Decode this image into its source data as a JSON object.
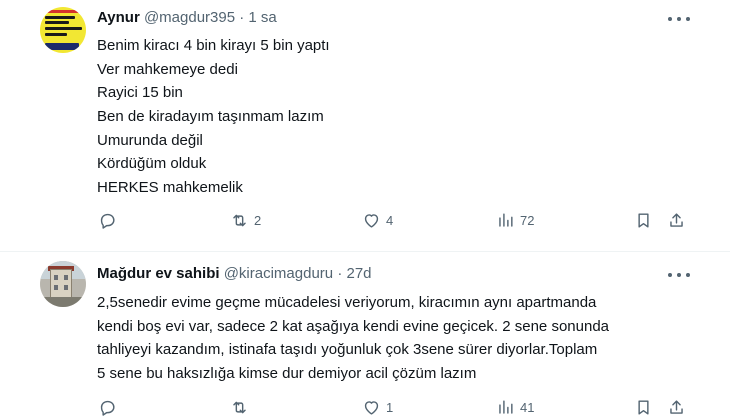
{
  "tweets": [
    {
      "author": {
        "name": "Aynur",
        "handle": "@magdur395",
        "time": "1 sa",
        "avatar_text": [
          "SON 2520 GÜN",
          "KURALI"
        ]
      },
      "separator": "·",
      "lines": [
        "Benim kiracı 4 bin kirayı 5 bin yaptı",
        "Ver mahkemeye dedi",
        "Rayici 15 bin",
        "Ben de kiradayım taşınmam lazım",
        "Umurunda değil",
        "Kördüğüm olduk",
        "HERKES mahkemelik"
      ],
      "actions": {
        "reply": "",
        "retweet": "2",
        "like": "4",
        "views": "72"
      }
    },
    {
      "author": {
        "name": "Mağdur ev sahibi",
        "handle": "@kiracimagduru",
        "time": "27d"
      },
      "separator": "·",
      "lines": [
        "2,5senedir evime geçme mücadelesi veriyorum, kiracımın aynı apartmanda",
        "kendi boş evi var, sadece 2 kat aşağıya kendi evine geçicek. 2 sene sonunda",
        "tahliyeyi kazandım, istinafa taşıdı yoğunluk çok 3sene sürer diyorlar.Toplam",
        "5 sene bu haksızlığa kimse dur demiyor acil çözüm lazım"
      ],
      "actions": {
        "reply": "",
        "retweet": "",
        "like": "1",
        "views": "41"
      }
    }
  ],
  "icons": {
    "reply": "comment-icon",
    "retweet": "retweet-icon",
    "like": "heart-icon",
    "views": "views-icon",
    "bookmark": "bookmark-icon",
    "share": "share-icon",
    "more": "more-icon"
  },
  "colors": {
    "text": "#0f1419",
    "secondary": "#536471",
    "divider": "#eff3f4"
  }
}
